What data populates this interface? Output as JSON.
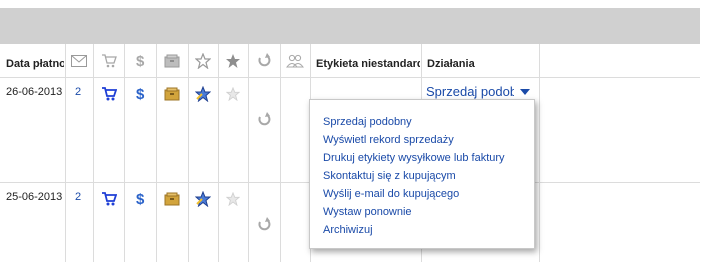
{
  "table": {
    "headers": {
      "payment_date": "Data płatności",
      "custom_label": "Etykieta niestandardowa",
      "actions": "Działania"
    },
    "header_icons": [
      "envelope-icon",
      "cart-icon",
      "dollar-icon",
      "package-icon",
      "star-feedback-icon",
      "star-filled-icon",
      "undo-icon",
      "users-icon"
    ],
    "rows": [
      {
        "date": "26-06-2013",
        "count": "2"
      },
      {
        "date": "25-06-2013",
        "count": "2"
      }
    ]
  },
  "actions": {
    "sell_similar": "Sprzedaj podobny"
  },
  "menu": {
    "items": [
      "Sprzedaj podobny",
      "Wyświetl rekord sprzedaży",
      "Drukuj etykiety wysyłkowe lub faktury",
      "Skontaktuj się z kupującym",
      "Wyślij e-mail do kupującego",
      "Wystaw ponownie",
      "Archiwizuj"
    ]
  },
  "colors": {
    "link": "#1a4aa8",
    "header_bar": "#d0d0d0",
    "grid": "#dcdcdc",
    "cart_blue": "#1f3fd6",
    "dollar_blue": "#2a62c9",
    "package_gold": "#d2a43c"
  }
}
